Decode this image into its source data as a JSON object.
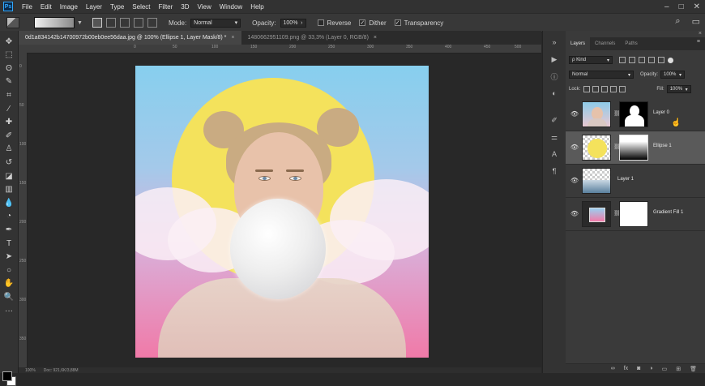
{
  "app": {
    "logo": "Ps"
  },
  "menu": [
    "File",
    "Edit",
    "Image",
    "Layer",
    "Type",
    "Select",
    "Filter",
    "3D",
    "View",
    "Window",
    "Help"
  ],
  "window_controls": {
    "minimize": "–",
    "maximize": "□",
    "close": "✕"
  },
  "options": {
    "mode_label": "Mode:",
    "mode_value": "Normal",
    "opacity_label": "Opacity:",
    "opacity_value": "100%",
    "reverse_label": "Reverse",
    "dither_label": "Dither",
    "transparency_label": "Transparency",
    "reverse_checked": false,
    "dither_checked": true,
    "transparency_checked": true,
    "search_icon": "⌕",
    "workspace_icon": "▭"
  },
  "tabs": [
    {
      "title": "0d1a834142b14700972b00eb0ee56daa.jpg @ 100% (Ellipse 1, Layer Mask/8) *",
      "close": "×"
    },
    {
      "title": "1480662951109.png @ 33,3% (Layer 0, RGB/8)",
      "close": "×"
    }
  ],
  "rulers": {
    "top": [
      "0",
      "50",
      "100",
      "150",
      "200",
      "250",
      "300",
      "350",
      "400",
      "450",
      "500",
      "550"
    ],
    "left": [
      "0",
      "50",
      "100",
      "150",
      "200",
      "250",
      "300",
      "350"
    ]
  },
  "status": {
    "zoom": "100%",
    "doc": "Doc: 921,6K/3,88M"
  },
  "tools": [
    {
      "name": "move-tool-icon",
      "glyph": "✥"
    },
    {
      "name": "marquee-tool-icon",
      "glyph": "⬚"
    },
    {
      "name": "lasso-tool-icon",
      "glyph": "ʘ"
    },
    {
      "name": "quick-select-tool-icon",
      "glyph": "✎"
    },
    {
      "name": "crop-tool-icon",
      "glyph": "⌗"
    },
    {
      "name": "eyedropper-tool-icon",
      "glyph": "⁄"
    },
    {
      "name": "healing-brush-icon",
      "glyph": "✚"
    },
    {
      "name": "brush-tool-icon",
      "glyph": "✐"
    },
    {
      "name": "clone-stamp-icon",
      "glyph": "♙"
    },
    {
      "name": "history-brush-icon",
      "glyph": "↺"
    },
    {
      "name": "eraser-tool-icon",
      "glyph": "◪"
    },
    {
      "name": "gradient-tool-icon",
      "glyph": "▥"
    },
    {
      "name": "blur-tool-icon",
      "glyph": "💧"
    },
    {
      "name": "dodge-tool-icon",
      "glyph": "◔"
    },
    {
      "name": "pen-tool-icon",
      "glyph": "✒"
    },
    {
      "name": "type-tool-icon",
      "glyph": "T"
    },
    {
      "name": "path-select-icon",
      "glyph": "➤"
    },
    {
      "name": "ellipse-tool-icon",
      "glyph": "○"
    },
    {
      "name": "hand-tool-icon",
      "glyph": "✋"
    },
    {
      "name": "zoom-tool-icon",
      "glyph": "🔍"
    },
    {
      "name": "more-tools-icon",
      "glyph": "···"
    }
  ],
  "colors": {
    "foreground": "#000000",
    "background": "#ffffff",
    "accent": "#31a8ff"
  },
  "dock_icons": [
    {
      "name": "collapse-icon",
      "glyph": "»"
    },
    {
      "name": "play-icon",
      "glyph": "▶"
    },
    {
      "name": "info-icon",
      "glyph": "ⓘ"
    },
    {
      "name": "adjust-icon",
      "glyph": "◐"
    },
    {
      "name": "brush-settings-icon",
      "glyph": "✐"
    },
    {
      "name": "sliders-icon",
      "glyph": "⚌"
    },
    {
      "name": "character-icon",
      "glyph": "A"
    },
    {
      "name": "paragraph-icon",
      "glyph": "¶"
    }
  ],
  "layers_panel": {
    "tabs": [
      "Layers",
      "Channels",
      "Paths"
    ],
    "menu_icon": "≡",
    "close_icon": "×",
    "kind_label": "Kind",
    "kind_icon": "ρ",
    "blend_mode": "Normal",
    "opacity_label": "Opacity:",
    "opacity_value": "100%",
    "lock_label": "Lock:",
    "fill_label": "Fill:",
    "fill_value": "100%",
    "footer_icons": [
      {
        "name": "link-layers-icon",
        "glyph": "∞"
      },
      {
        "name": "fx-icon",
        "glyph": "fx"
      },
      {
        "name": "mask-icon",
        "glyph": "◙"
      },
      {
        "name": "adjustment-layer-icon",
        "glyph": "◑"
      },
      {
        "name": "group-icon",
        "glyph": "▭"
      },
      {
        "name": "new-layer-icon",
        "glyph": "⊞"
      },
      {
        "name": "delete-layer-icon",
        "glyph": "🗑"
      }
    ],
    "layers": [
      {
        "name": "Layer 0",
        "visible": true,
        "selected": false
      },
      {
        "name": "Ellipse 1",
        "visible": true,
        "selected": true
      },
      {
        "name": "Layer 1",
        "visible": true,
        "selected": false
      },
      {
        "name": "Gradient Fill 1",
        "visible": true,
        "selected": false
      }
    ]
  }
}
